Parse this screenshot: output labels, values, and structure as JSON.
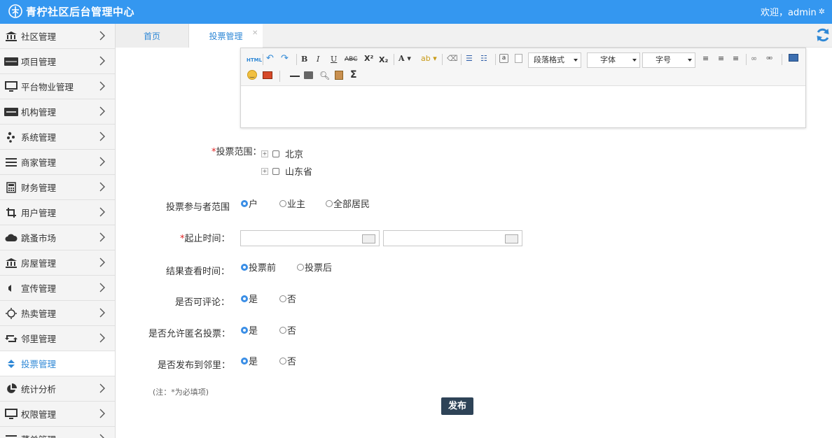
{
  "header": {
    "title": "青柠社区后台管理中心",
    "welcome": "欢迎，admin"
  },
  "sidebar": {
    "items": [
      {
        "label": "社区管理",
        "icon": "bank-icon"
      },
      {
        "label": "项目管理",
        "icon": "discover-card-icon"
      },
      {
        "label": "平台物业管理",
        "icon": "monitor-icon"
      },
      {
        "label": "机构管理",
        "icon": "stripe-icon"
      },
      {
        "label": "系统管理",
        "icon": "yelp-icon"
      },
      {
        "label": "商家管理",
        "icon": "list-icon"
      },
      {
        "label": "财务管理",
        "icon": "calculator-icon"
      },
      {
        "label": "用户管理",
        "icon": "crop-icon"
      },
      {
        "label": "跳蚤市场",
        "icon": "cloud-icon"
      },
      {
        "label": "房屋管理",
        "icon": "bank-icon"
      },
      {
        "label": "宣传管理",
        "icon": "volume-icon"
      },
      {
        "label": "热卖管理",
        "icon": "sun-icon"
      },
      {
        "label": "邻里管理",
        "icon": "retweet-icon"
      },
      {
        "label": "投票管理",
        "icon": "sort-icon",
        "active": true
      },
      {
        "label": "统计分析",
        "icon": "pie-chart-icon"
      },
      {
        "label": "权限管理",
        "icon": "monitor-icon"
      },
      {
        "label": "菜单管理",
        "icon": "list-icon"
      }
    ]
  },
  "tabs": {
    "home": "首页",
    "vote": "投票管理"
  },
  "editor": {
    "html_label": "HTML",
    "paragraph_select": "段落格式",
    "font_select": "字体",
    "size_select": "字号"
  },
  "form": {
    "scope": {
      "label": "投票范围：",
      "required_mark": "*",
      "options": [
        "北京",
        "山东省"
      ]
    },
    "participants": {
      "label": "投票参与者范围",
      "options": [
        "户",
        "业主",
        "全部居民"
      ],
      "selected": "户"
    },
    "period": {
      "label": "起止时间：",
      "required_mark": "*"
    },
    "result_view": {
      "label": "结果查看时间：",
      "options": [
        "投票前",
        "投票后"
      ],
      "selected": "投票前"
    },
    "commentable": {
      "label": "是否可评论：",
      "options": [
        "是",
        "否"
      ],
      "selected": "是"
    },
    "anonymous": {
      "label": "是否允许匿名投票：",
      "options": [
        "是",
        "否"
      ],
      "selected": "是"
    },
    "publish_neighbor": {
      "label": "是否发布到邻里：",
      "options": [
        "是",
        "否"
      ],
      "selected": "是"
    },
    "note": "(注：*为必填项)",
    "publish_button": "发布"
  },
  "colors": {
    "header": "#3497f0",
    "accent": "#2f88d6",
    "button": "#2e4357",
    "required": "#e02020"
  }
}
